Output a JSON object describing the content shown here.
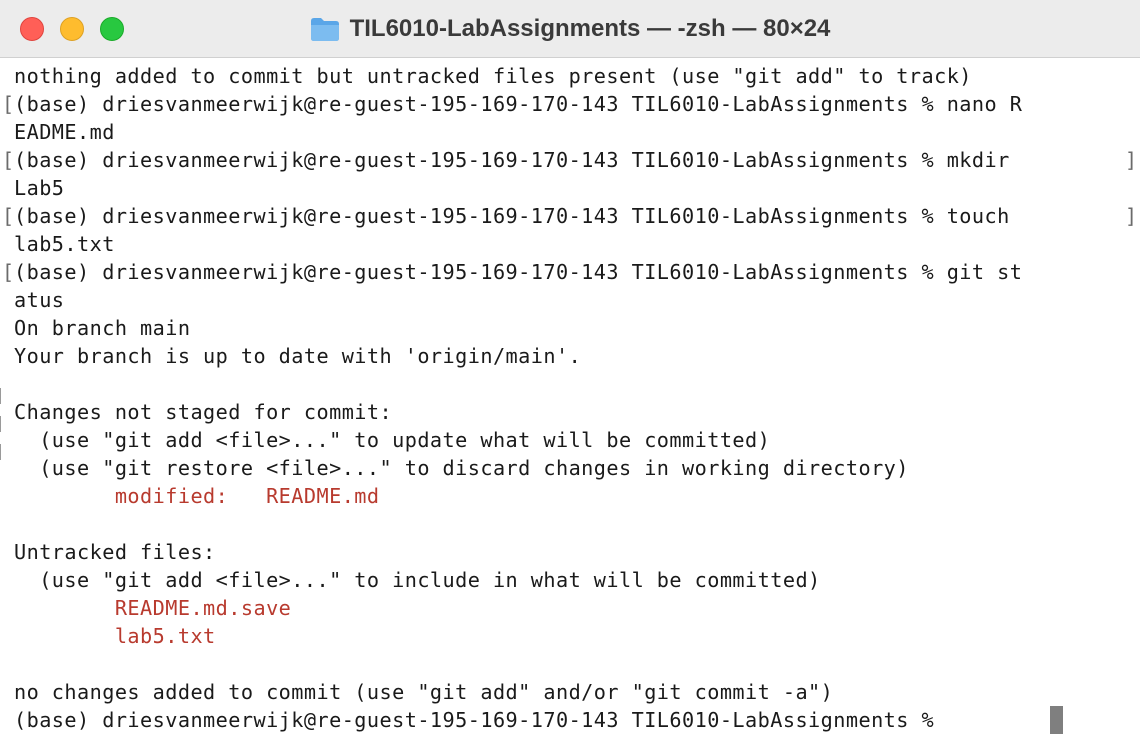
{
  "window": {
    "title": "TIL6010-LabAssignments — -zsh — 80×24",
    "folder_icon": "folder-icon"
  },
  "terminal": {
    "lines": [
      {
        "text": "nothing added to commit but untracked files present (use \"git add\" to track)"
      },
      {
        "text": "(base) driesvanmeerwijk@re-guest-195-169-170-143 TIL6010-LabAssignments % nano R"
      },
      {
        "text": "EADME.md"
      },
      {
        "text": "(base) driesvanmeerwijk@re-guest-195-169-170-143 TIL6010-LabAssignments % mkdir "
      },
      {
        "text": "Lab5"
      },
      {
        "text": "(base) driesvanmeerwijk@re-guest-195-169-170-143 TIL6010-LabAssignments % touch "
      },
      {
        "text": "lab5.txt"
      },
      {
        "text": "(base) driesvanmeerwijk@re-guest-195-169-170-143 TIL6010-LabAssignments % git st"
      },
      {
        "text": "atus"
      },
      {
        "text": "On branch main"
      },
      {
        "text": "Your branch is up to date with 'origin/main'."
      },
      {
        "text": ""
      },
      {
        "text": "Changes not staged for commit:"
      },
      {
        "text": "  (use \"git add <file>...\" to update what will be committed)"
      },
      {
        "text": "  (use \"git restore <file>...\" to discard changes in working directory)"
      },
      {
        "text": "        modified:   README.md"
      },
      {
        "text": ""
      },
      {
        "text": "Untracked files:"
      },
      {
        "text": "  (use \"git add <file>...\" to include in what will be committed)"
      },
      {
        "text": "        README.md.save"
      },
      {
        "text": "        lab5.txt"
      },
      {
        "text": ""
      },
      {
        "text": "no changes added to commit (use \"git add\" and/or \"git commit -a\")"
      },
      {
        "text": "(base) driesvanmeerwijk@re-guest-195-169-170-143 TIL6010-LabAssignments % "
      }
    ]
  },
  "colors": {
    "git_status_red": "#b83a2e",
    "close": "#ff5f57",
    "minimize": "#febc2e",
    "maximize": "#28c840"
  }
}
